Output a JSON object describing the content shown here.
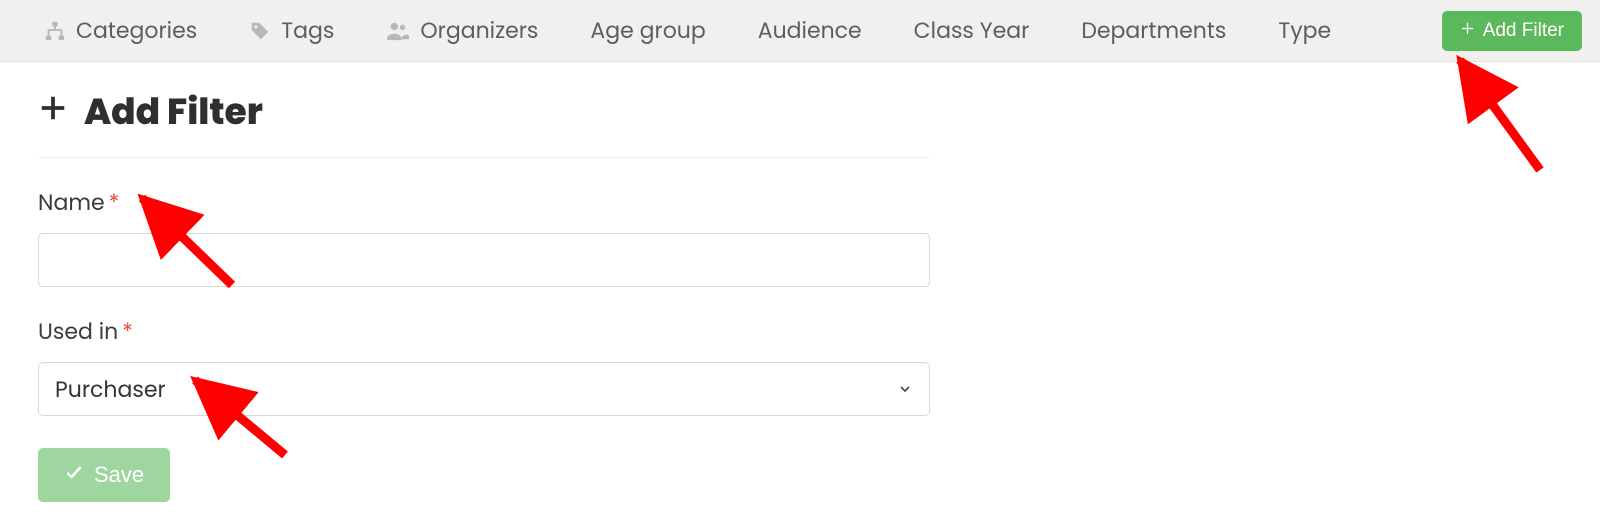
{
  "tabs": {
    "categories": "Categories",
    "tags": "Tags",
    "organizers": "Organizers",
    "age_group": "Age group",
    "audience": "Audience",
    "class_year": "Class Year",
    "departments": "Departments",
    "type": "Type"
  },
  "header_button": {
    "add_filter": "Add Filter"
  },
  "page": {
    "title": "Add Filter",
    "name_label": "Name",
    "name_value": "",
    "used_in_label": "Used in",
    "used_in_value": "Purchaser",
    "save_label": "Save"
  },
  "colors": {
    "accent_green": "#5cb85c",
    "save_green": "#9fd59f",
    "required_red": "#e74c3c",
    "annotation_red": "#ff0000"
  }
}
